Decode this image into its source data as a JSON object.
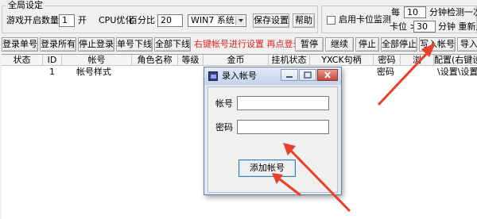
{
  "global": {
    "group_title": "全局设定",
    "game_count_label": "游戏开启数量",
    "game_count_value": "1",
    "open_label": "开",
    "cpu_label": "CPU优化",
    "percent_label": "百分比",
    "percent_value": "20",
    "os_value": "WIN7 系统",
    "save_label": "保存设置",
    "help_label": "帮助"
  },
  "card_monitor": {
    "enable_label": "启用卡位监测",
    "every_label": "每",
    "every_value": "10",
    "every_suffix": "分钟检测一次一",
    "card_label": "卡位 >",
    "card_value": "30",
    "card_suffix": "分钟 重新上"
  },
  "toolbar": {
    "login_one": "登录单号",
    "login_all": "登录所有",
    "stop_login": "停止登录",
    "logout_one": "单号下线",
    "logout_all": "全部下线",
    "hint": "右键帐号进行设置 再点登录",
    "pause": "暂停",
    "resume": "继续",
    "stop": "停止",
    "stop_all": "全部停止",
    "import_account": "写入帐号",
    "import_cut": "导入"
  },
  "table": {
    "headers": [
      "状态",
      "ID",
      "帐号",
      "角色名称",
      "等级",
      "金币",
      "挂机状态",
      "YXCK句柄",
      "密码",
      "浏",
      "配置(右键设"
    ],
    "rows": [
      {
        "status": "",
        "id": "1",
        "account": "帐号样式",
        "role": "",
        "level": "",
        "gold": "",
        "hang": "",
        "handle": "",
        "password": "密码",
        "browser": "",
        "config": "\\设置\\设置\\"
      }
    ]
  },
  "dialog": {
    "title": "录入帐号",
    "account_label": "帐号",
    "account_value": "",
    "password_label": "密码",
    "password_value": "",
    "add_button": "添加帐号"
  },
  "colors": {
    "arrow": "#e8402a",
    "hint_text": "#e02020",
    "dialog_title_bg": "#c8d8ee"
  }
}
